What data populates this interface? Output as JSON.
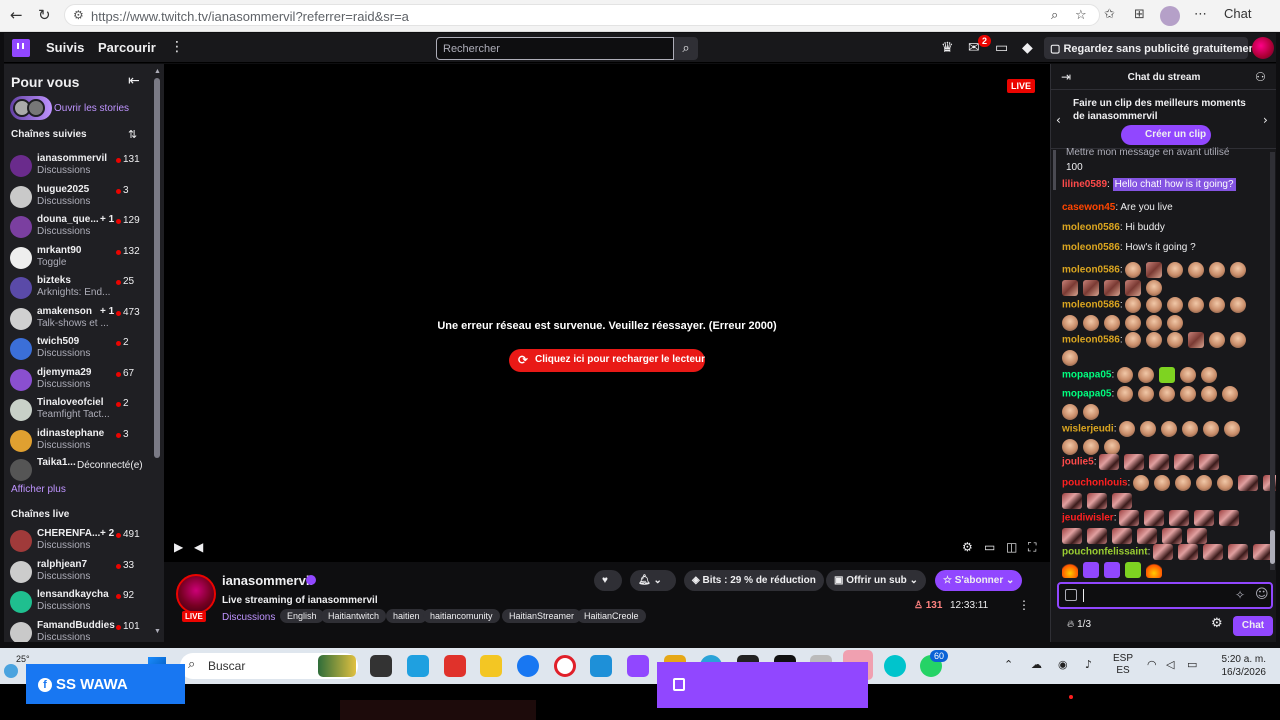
{
  "browser": {
    "url": "https://www.twitch.tv/ianasommervil?referrer=raid&sr=a",
    "chat_label": "Chat"
  },
  "topnav": {
    "following": "Suivis",
    "browse": "Parcourir",
    "search_placeholder": "Rechercher",
    "notif_count": "2",
    "adfree_label": "Regardez sans publicité gratuitement"
  },
  "sidebar": {
    "title": "Pour vous",
    "stories_label": "Ouvrir les stories",
    "followed_title": "Chaînes suivies",
    "followed": [
      {
        "name": "ianasommervil",
        "game": "Discussions",
        "viewers": "131",
        "color": "#6a2b8c"
      },
      {
        "name": "hugue2025",
        "game": "Discussions",
        "viewers": "3",
        "color": "#c9c9c9"
      },
      {
        "name": "douna_que...",
        "extra": "+ 1",
        "game": "Discussions",
        "viewers": "129",
        "color": "#7b3fa0"
      },
      {
        "name": "mrkant90",
        "game": "Toggle",
        "viewers": "132",
        "color": "#eeeeee"
      },
      {
        "name": "bizteks",
        "game": "Arknights: End...",
        "viewers": "25",
        "color": "#5a4aa8"
      },
      {
        "name": "amakenson",
        "extra": "+ 1",
        "game": "Talk-shows et ...",
        "viewers": "473",
        "color": "#d0d0d0"
      },
      {
        "name": "twich509",
        "game": "Discussions",
        "viewers": "2",
        "color": "#3b6fd8"
      },
      {
        "name": "djemyma29",
        "game": "Discussions",
        "viewers": "67",
        "color": "#8a4fd0"
      },
      {
        "name": "Tinaloveofciel",
        "game": "Teamfight Tact...",
        "viewers": "2",
        "color": "#c8d0c8"
      },
      {
        "name": "idinastephane",
        "game": "Discussions",
        "viewers": "3",
        "color": "#e0a030"
      }
    ],
    "offline": {
      "name": "Taika1...",
      "status": "Déconnecté(e)",
      "color": "#555555"
    },
    "show_more": "Afficher plus",
    "live_title": "Chaînes live",
    "live": [
      {
        "name": "CHERENFA...",
        "extra": "+ 2",
        "game": "Discussions",
        "viewers": "491",
        "color": "#a03a3a"
      },
      {
        "name": "ralphjean7",
        "game": "Discussions",
        "viewers": "33",
        "color": "#cccccc"
      },
      {
        "name": "lensandkaycha",
        "game": "Discussions",
        "viewers": "92",
        "color": "#1fbf8f"
      },
      {
        "name": "FamandBuddies",
        "game": "Discussions",
        "viewers": "101",
        "color": "#c9c9c9"
      }
    ]
  },
  "player": {
    "live_badge": "LIVE",
    "error_message": "Une erreur réseau est survenue. Veuillez réessayer. (Erreur 2000)",
    "reload_label": "Cliquez ici pour recharger le lecteur"
  },
  "stream": {
    "streamer": "ianasommervil",
    "live_badge": "LIVE",
    "title": "Live streaming of ianasommervil",
    "category": "Discussions",
    "tags": [
      "English",
      "Haitiantwitch",
      "haitien",
      "haitiancomunity",
      "HaitianStreamer",
      "HaitianCreole"
    ],
    "bits_label": "Bits : 29 % de réduction",
    "gift_label": "Offrir un sub",
    "subscribe_label": "S'abonner",
    "viewers": "131",
    "uptime": "12:33:11"
  },
  "chat": {
    "title": "Chat du stream",
    "clip_text": "Faire un clip des meilleurs moments de ianasommervil",
    "clip_button": "Créer un clip",
    "pinned_line": "Mettre mon message en avant utilisé",
    "pinned_number": "100",
    "messages": [
      {
        "user": "liline0589",
        "color": "#ff4a4a",
        "text": "Hello chat! how is it going?",
        "highlight": true
      },
      {
        "user": "casewon45",
        "color": "#ff4500",
        "text": "Are you live"
      },
      {
        "user": "moleon0586",
        "color": "#daa520",
        "text": "Hi buddy"
      },
      {
        "user": "moleon0586",
        "color": "#daa520",
        "text": "How's it going ?"
      }
    ],
    "emote_users": [
      {
        "user": "moleon0586",
        "color": "#daa520"
      },
      {
        "user": "moleon0586",
        "color": "#daa520"
      },
      {
        "user": "moleon0586",
        "color": "#daa520"
      },
      {
        "user": "mopapa05",
        "color": "#00ff7f"
      },
      {
        "user": "mopapa05",
        "color": "#00ff7f"
      },
      {
        "user": "wislerjeudi",
        "color": "#daa520"
      },
      {
        "user": "joulie5",
        "color": "#ff4a4a"
      },
      {
        "user": "pouchonlouis",
        "color": "#ff2020"
      },
      {
        "user": "jeudiwisler",
        "color": "#ff2020"
      },
      {
        "user": "pouchonfelissaint",
        "color": "#9acd32"
      }
    ],
    "points": "1/3",
    "send_label": "Chat"
  },
  "taskbar": {
    "temperature": "25°",
    "search_label": "Buscar",
    "badge": "60",
    "lang_line1": "ESP",
    "lang_line2": "ES",
    "time": "5:20 a. m.",
    "date": "16/3/2026"
  },
  "overlay": {
    "facebook_text": "SS WAWA"
  },
  "colors": {
    "twitch_purple": "#9147ff",
    "live_red": "#eb0400",
    "error_button": "#e91916"
  }
}
